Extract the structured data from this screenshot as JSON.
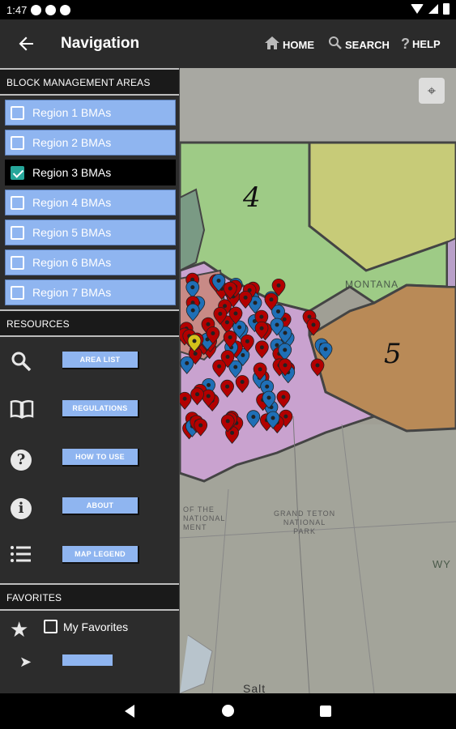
{
  "status_bar": {
    "time": "1:47"
  },
  "app_bar": {
    "title": "Navigation",
    "home_label": "HOME",
    "search_label": "SEARCH",
    "help_label": "HELP"
  },
  "drawer": {
    "bma_header": "BLOCK MANAGEMENT AREAS",
    "regions": [
      {
        "label": "Region 1 BMAs",
        "checked": false
      },
      {
        "label": "Region 2 BMAs",
        "checked": false
      },
      {
        "label": "Region 3 BMAs",
        "checked": true
      },
      {
        "label": "Region 4 BMAs",
        "checked": false
      },
      {
        "label": "Region 5 BMAs",
        "checked": false
      },
      {
        "label": "Region 6 BMAs",
        "checked": false
      },
      {
        "label": "Region 7 BMAs",
        "checked": false
      }
    ],
    "resources_header": "RESOURCES",
    "resources": [
      {
        "label": "AREA LIST",
        "icon": "search-icon"
      },
      {
        "label": "REGULATIONS",
        "icon": "book-icon"
      },
      {
        "label": "HOW TO USE",
        "icon": "question-icon"
      },
      {
        "label": "ABOUT",
        "icon": "info-icon"
      },
      {
        "label": "MAP LEGEND",
        "icon": "list-icon"
      }
    ],
    "favorites_header": "FAVORITES",
    "favorites_label": "My Favorites"
  },
  "map": {
    "region_4": "4",
    "region_5": "5",
    "montana": "MONTANA",
    "grand_teton_1": "GRAND TETON",
    "grand_teton_2": "NATIONAL",
    "grand_teton_3": "PARK",
    "national_1": "OF THE",
    "national_2": "NATIONAL",
    "national_3": "MENT",
    "wy": "WY",
    "salt": "Salt",
    "colors": {
      "region3": "#c9a2cf",
      "region4": "#9ecb86",
      "region5": "#b98a57",
      "region_top": "#c7cb78",
      "marker_red": "#b30000",
      "marker_blue": "#1f6fb6"
    }
  }
}
